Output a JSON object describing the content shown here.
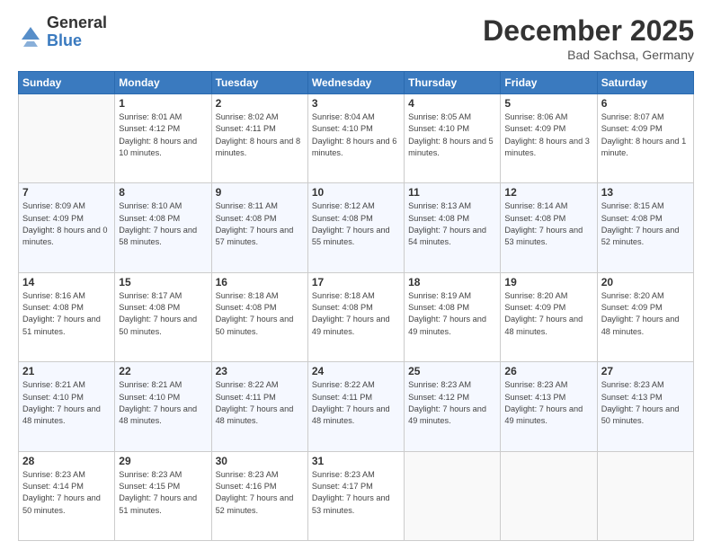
{
  "header": {
    "logo_general": "General",
    "logo_blue": "Blue",
    "month_title": "December 2025",
    "location": "Bad Sachsa, Germany"
  },
  "calendar": {
    "days_of_week": [
      "Sunday",
      "Monday",
      "Tuesday",
      "Wednesday",
      "Thursday",
      "Friday",
      "Saturday"
    ],
    "weeks": [
      [
        {
          "day": "",
          "sunrise": "",
          "sunset": "",
          "daylight": "",
          "empty": true
        },
        {
          "day": "1",
          "sunrise": "Sunrise: 8:01 AM",
          "sunset": "Sunset: 4:12 PM",
          "daylight": "Daylight: 8 hours and 10 minutes.",
          "empty": false
        },
        {
          "day": "2",
          "sunrise": "Sunrise: 8:02 AM",
          "sunset": "Sunset: 4:11 PM",
          "daylight": "Daylight: 8 hours and 8 minutes.",
          "empty": false
        },
        {
          "day": "3",
          "sunrise": "Sunrise: 8:04 AM",
          "sunset": "Sunset: 4:10 PM",
          "daylight": "Daylight: 8 hours and 6 minutes.",
          "empty": false
        },
        {
          "day": "4",
          "sunrise": "Sunrise: 8:05 AM",
          "sunset": "Sunset: 4:10 PM",
          "daylight": "Daylight: 8 hours and 5 minutes.",
          "empty": false
        },
        {
          "day": "5",
          "sunrise": "Sunrise: 8:06 AM",
          "sunset": "Sunset: 4:09 PM",
          "daylight": "Daylight: 8 hours and 3 minutes.",
          "empty": false
        },
        {
          "day": "6",
          "sunrise": "Sunrise: 8:07 AM",
          "sunset": "Sunset: 4:09 PM",
          "daylight": "Daylight: 8 hours and 1 minute.",
          "empty": false
        }
      ],
      [
        {
          "day": "7",
          "sunrise": "Sunrise: 8:09 AM",
          "sunset": "Sunset: 4:09 PM",
          "daylight": "Daylight: 8 hours and 0 minutes.",
          "empty": false
        },
        {
          "day": "8",
          "sunrise": "Sunrise: 8:10 AM",
          "sunset": "Sunset: 4:08 PM",
          "daylight": "Daylight: 7 hours and 58 minutes.",
          "empty": false
        },
        {
          "day": "9",
          "sunrise": "Sunrise: 8:11 AM",
          "sunset": "Sunset: 4:08 PM",
          "daylight": "Daylight: 7 hours and 57 minutes.",
          "empty": false
        },
        {
          "day": "10",
          "sunrise": "Sunrise: 8:12 AM",
          "sunset": "Sunset: 4:08 PM",
          "daylight": "Daylight: 7 hours and 55 minutes.",
          "empty": false
        },
        {
          "day": "11",
          "sunrise": "Sunrise: 8:13 AM",
          "sunset": "Sunset: 4:08 PM",
          "daylight": "Daylight: 7 hours and 54 minutes.",
          "empty": false
        },
        {
          "day": "12",
          "sunrise": "Sunrise: 8:14 AM",
          "sunset": "Sunset: 4:08 PM",
          "daylight": "Daylight: 7 hours and 53 minutes.",
          "empty": false
        },
        {
          "day": "13",
          "sunrise": "Sunrise: 8:15 AM",
          "sunset": "Sunset: 4:08 PM",
          "daylight": "Daylight: 7 hours and 52 minutes.",
          "empty": false
        }
      ],
      [
        {
          "day": "14",
          "sunrise": "Sunrise: 8:16 AM",
          "sunset": "Sunset: 4:08 PM",
          "daylight": "Daylight: 7 hours and 51 minutes.",
          "empty": false
        },
        {
          "day": "15",
          "sunrise": "Sunrise: 8:17 AM",
          "sunset": "Sunset: 4:08 PM",
          "daylight": "Daylight: 7 hours and 50 minutes.",
          "empty": false
        },
        {
          "day": "16",
          "sunrise": "Sunrise: 8:18 AM",
          "sunset": "Sunset: 4:08 PM",
          "daylight": "Daylight: 7 hours and 50 minutes.",
          "empty": false
        },
        {
          "day": "17",
          "sunrise": "Sunrise: 8:18 AM",
          "sunset": "Sunset: 4:08 PM",
          "daylight": "Daylight: 7 hours and 49 minutes.",
          "empty": false
        },
        {
          "day": "18",
          "sunrise": "Sunrise: 8:19 AM",
          "sunset": "Sunset: 4:08 PM",
          "daylight": "Daylight: 7 hours and 49 minutes.",
          "empty": false
        },
        {
          "day": "19",
          "sunrise": "Sunrise: 8:20 AM",
          "sunset": "Sunset: 4:09 PM",
          "daylight": "Daylight: 7 hours and 48 minutes.",
          "empty": false
        },
        {
          "day": "20",
          "sunrise": "Sunrise: 8:20 AM",
          "sunset": "Sunset: 4:09 PM",
          "daylight": "Daylight: 7 hours and 48 minutes.",
          "empty": false
        }
      ],
      [
        {
          "day": "21",
          "sunrise": "Sunrise: 8:21 AM",
          "sunset": "Sunset: 4:10 PM",
          "daylight": "Daylight: 7 hours and 48 minutes.",
          "empty": false
        },
        {
          "day": "22",
          "sunrise": "Sunrise: 8:21 AM",
          "sunset": "Sunset: 4:10 PM",
          "daylight": "Daylight: 7 hours and 48 minutes.",
          "empty": false
        },
        {
          "day": "23",
          "sunrise": "Sunrise: 8:22 AM",
          "sunset": "Sunset: 4:11 PM",
          "daylight": "Daylight: 7 hours and 48 minutes.",
          "empty": false
        },
        {
          "day": "24",
          "sunrise": "Sunrise: 8:22 AM",
          "sunset": "Sunset: 4:11 PM",
          "daylight": "Daylight: 7 hours and 48 minutes.",
          "empty": false
        },
        {
          "day": "25",
          "sunrise": "Sunrise: 8:23 AM",
          "sunset": "Sunset: 4:12 PM",
          "daylight": "Daylight: 7 hours and 49 minutes.",
          "empty": false
        },
        {
          "day": "26",
          "sunrise": "Sunrise: 8:23 AM",
          "sunset": "Sunset: 4:13 PM",
          "daylight": "Daylight: 7 hours and 49 minutes.",
          "empty": false
        },
        {
          "day": "27",
          "sunrise": "Sunrise: 8:23 AM",
          "sunset": "Sunset: 4:13 PM",
          "daylight": "Daylight: 7 hours and 50 minutes.",
          "empty": false
        }
      ],
      [
        {
          "day": "28",
          "sunrise": "Sunrise: 8:23 AM",
          "sunset": "Sunset: 4:14 PM",
          "daylight": "Daylight: 7 hours and 50 minutes.",
          "empty": false
        },
        {
          "day": "29",
          "sunrise": "Sunrise: 8:23 AM",
          "sunset": "Sunset: 4:15 PM",
          "daylight": "Daylight: 7 hours and 51 minutes.",
          "empty": false
        },
        {
          "day": "30",
          "sunrise": "Sunrise: 8:23 AM",
          "sunset": "Sunset: 4:16 PM",
          "daylight": "Daylight: 7 hours and 52 minutes.",
          "empty": false
        },
        {
          "day": "31",
          "sunrise": "Sunrise: 8:23 AM",
          "sunset": "Sunset: 4:17 PM",
          "daylight": "Daylight: 7 hours and 53 minutes.",
          "empty": false
        },
        {
          "day": "",
          "sunrise": "",
          "sunset": "",
          "daylight": "",
          "empty": true
        },
        {
          "day": "",
          "sunrise": "",
          "sunset": "",
          "daylight": "",
          "empty": true
        },
        {
          "day": "",
          "sunrise": "",
          "sunset": "",
          "daylight": "",
          "empty": true
        }
      ]
    ]
  }
}
